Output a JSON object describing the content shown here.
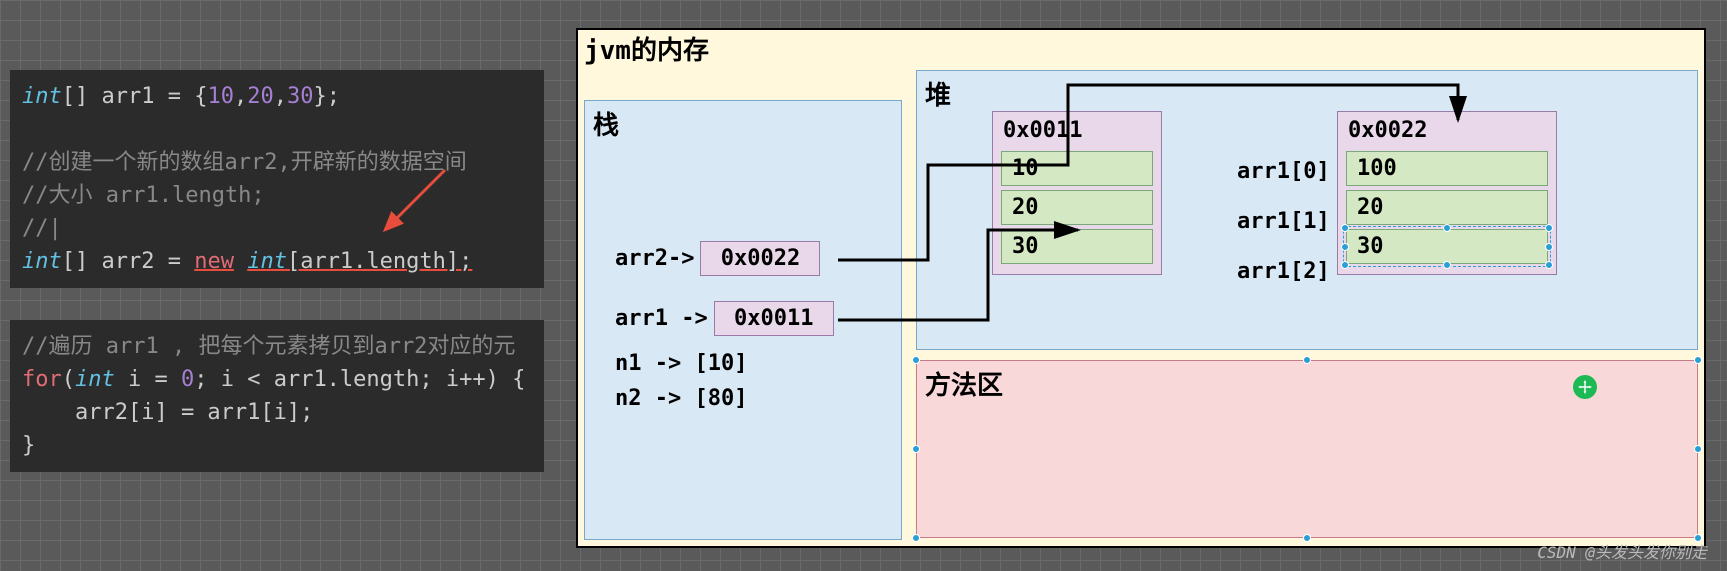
{
  "code": {
    "block1": {
      "l1_type": "int",
      "l1_rest": "[] arr1 = {",
      "l1_n1": "10",
      "l1_c1": ",",
      "l1_n2": "20",
      "l1_c2": ",",
      "l1_n3": "30",
      "l1_end": "};",
      "l3_comment": "//创建一个新的数组arr2,开辟新的数据空间",
      "l4_comment": "//大小 arr1.length;",
      "l5_comment": "//|",
      "l6_type1": "int",
      "l6_a": "[] arr2 = ",
      "l6_new": "new",
      "l6_b": " ",
      "l6_type2": "int",
      "l6_c": "[arr1.length];"
    },
    "block2": {
      "l1_comment": "//遍历 arr1 , 把每个元素拷贝到arr2对应的元",
      "l2_for": "for",
      "l2_a": "(",
      "l2_type": "int",
      "l2_b": " i = ",
      "l2_zero": "0",
      "l2_c": "; i < arr1.length; i++) {",
      "l3": "    arr2[i] = arr1[i];",
      "l4": "}"
    }
  },
  "jvm": {
    "title": "jvm的内存",
    "stack": {
      "title": "栈",
      "arr2_label": "arr2->",
      "arr2_val": "0x0022",
      "arr1_label": "arr1 ->",
      "arr1_val": "0x0011",
      "n1": "n1 -> [10]",
      "n2": "n2 -> [80]"
    },
    "heap": {
      "title": "堆",
      "obj1": {
        "addr": "0x0011",
        "v0": "10",
        "v1": "20",
        "v2": "30"
      },
      "obj2": {
        "addr": "0x0022",
        "v0": "100",
        "v1": "20",
        "v2": "30"
      },
      "idx0": "arr1[0]",
      "idx1": "arr1[1]",
      "idx2": "arr1[2]"
    },
    "method": {
      "title": "方法区"
    }
  },
  "watermark": "CSDN @头发头发你别走"
}
